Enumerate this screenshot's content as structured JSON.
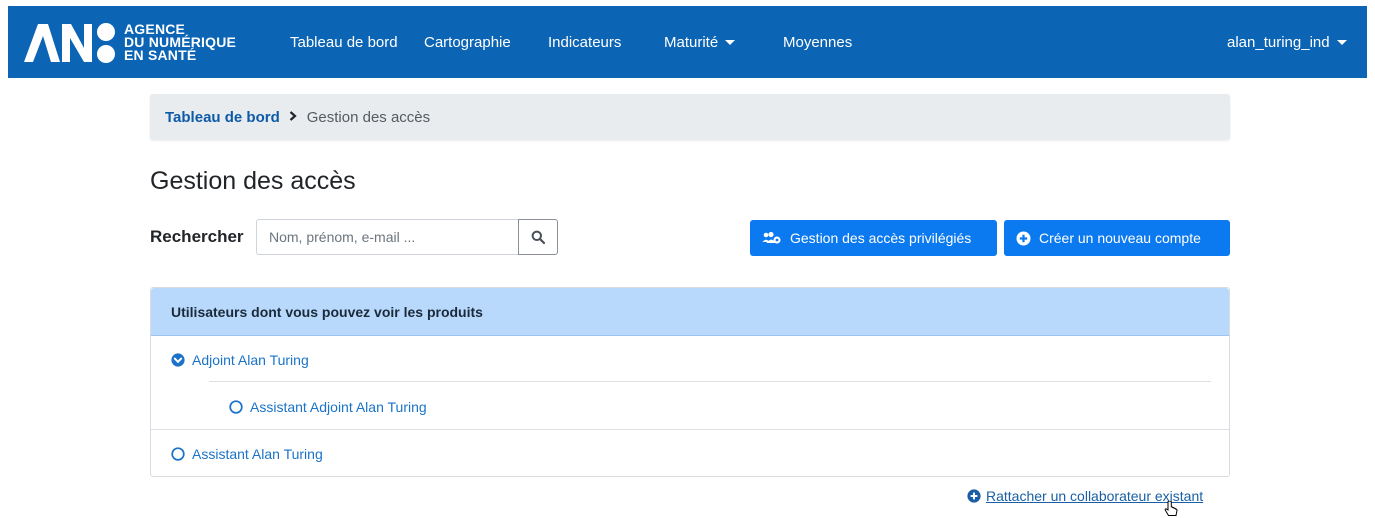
{
  "navbar": {
    "brand": {
      "line1": "AGENCE",
      "line2": "DU NUMÉRIQUE",
      "line3": "EN SANTÉ",
      "logo_letters": "ANS"
    },
    "items": [
      {
        "label": "Tableau de bord"
      },
      {
        "label": "Cartographie"
      },
      {
        "label": "Indicateurs"
      },
      {
        "label": "Maturité",
        "has_dropdown": true
      },
      {
        "label": "Moyennes"
      }
    ],
    "user": {
      "label": "alan_turing_ind",
      "has_dropdown": true
    }
  },
  "breadcrumb": {
    "parent": "Tableau de bord",
    "current": "Gestion des accès"
  },
  "page": {
    "title": "Gestion des accès"
  },
  "search": {
    "label": "Rechercher",
    "placeholder": "Nom, prénom, e-mail ...",
    "value": "",
    "button_icon": "search-icon"
  },
  "actions": {
    "privileged_label": "Gestion des accès privilégiés",
    "privileged_icon": "users-cog-icon",
    "create_label": "Créer un nouveau compte",
    "create_icon": "plus-circle-icon"
  },
  "users_card": {
    "header": "Utilisateurs dont vous pouvez voir les produits",
    "users": [
      {
        "name": "Adjoint Alan Turing",
        "state": "expanded",
        "icon": "check-circle-icon"
      },
      {
        "name": "Assistant Adjoint Alan Turing",
        "state": "child",
        "icon": "circle-icon"
      },
      {
        "name": "Assistant Alan Turing",
        "state": "collapsed",
        "icon": "circle-icon"
      }
    ]
  },
  "footer_link": {
    "label": "Rattacher un collaborateur existant",
    "icon": "plus-circle-icon"
  },
  "colors": {
    "navbar": "#0b64b4",
    "primary_button": "#0b7af0",
    "card_header": "#b8d9fb",
    "link": "#1a73c8"
  }
}
